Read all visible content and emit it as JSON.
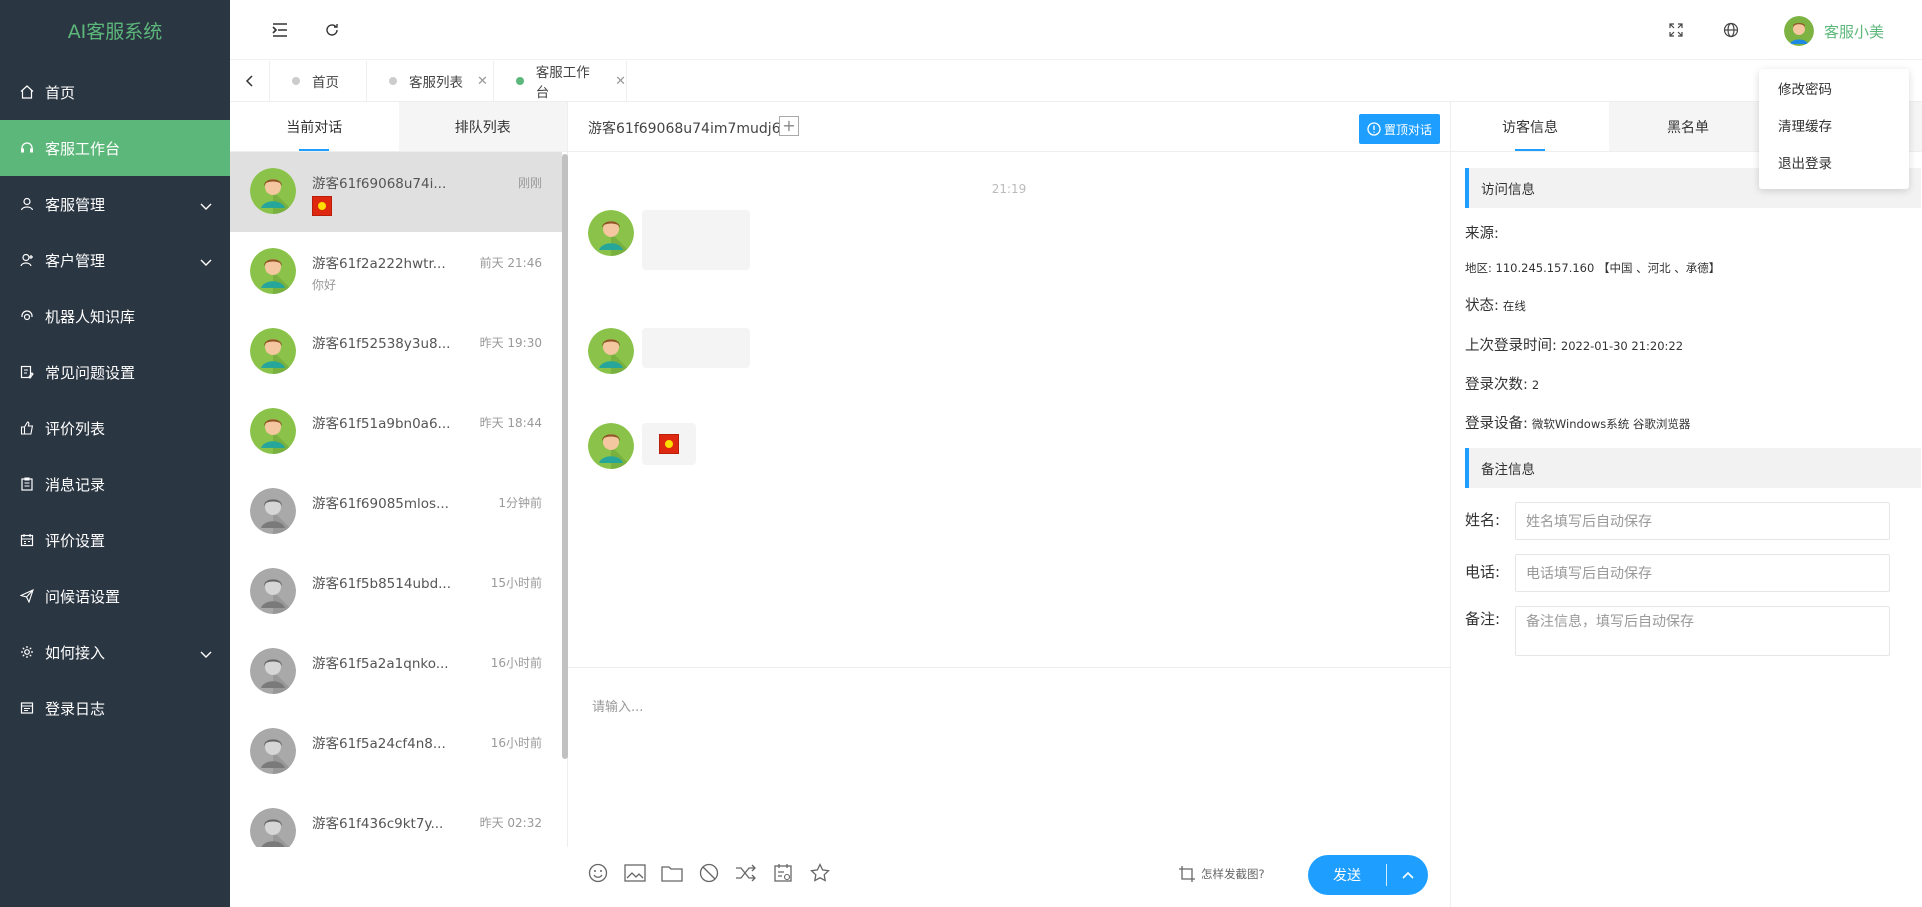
{
  "app": {
    "title": "AI客服系统"
  },
  "sidebar": {
    "items": [
      {
        "label": "首页",
        "icon": "home-icon"
      },
      {
        "label": "客服工作台",
        "icon": "headset-icon",
        "active": true
      },
      {
        "label": "客服管理",
        "icon": "user-icon",
        "expandable": true
      },
      {
        "label": "客户管理",
        "icon": "customer-icon",
        "expandable": true
      },
      {
        "label": "机器人知识库",
        "icon": "robot-icon"
      },
      {
        "label": "常见问题设置",
        "icon": "faq-icon"
      },
      {
        "label": "评价列表",
        "icon": "thumbs-up-icon"
      },
      {
        "label": "消息记录",
        "icon": "clipboard-icon"
      },
      {
        "label": "评价设置",
        "icon": "calendar-icon"
      },
      {
        "label": "问候语设置",
        "icon": "paper-plane-icon"
      },
      {
        "label": "如何接入",
        "icon": "gear-icon",
        "expandable": true
      },
      {
        "label": "登录日志",
        "icon": "log-icon"
      }
    ]
  },
  "header": {
    "user_name": "客服小美"
  },
  "user_menu": {
    "items": [
      "修改密码",
      "清理缓存",
      "退出登录"
    ]
  },
  "tabs": [
    {
      "label": "首页",
      "closable": false
    },
    {
      "label": "客服列表",
      "closable": true
    },
    {
      "label": "客服工作台",
      "closable": true,
      "active": true
    }
  ],
  "conversations": {
    "tabs": [
      "当前对话",
      "排队列表"
    ],
    "list": [
      {
        "name": "游客61f69068u74i...",
        "time": "刚刚",
        "preview": "",
        "flag": true,
        "online": true,
        "selected": true
      },
      {
        "name": "游客61f2a222hwtr...",
        "time": "前天 21:46",
        "preview": "你好",
        "online": true
      },
      {
        "name": "游客61f52538y3u8...",
        "time": "昨天 19:30",
        "preview": "",
        "online": true
      },
      {
        "name": "游客61f51a9bn0a6...",
        "time": "昨天 18:44",
        "preview": "",
        "online": true
      },
      {
        "name": "游客61f69085mlos...",
        "time": "1分钟前",
        "preview": "",
        "online": false
      },
      {
        "name": "游客61f5b8514ubd...",
        "time": "15小时前",
        "preview": "",
        "online": false
      },
      {
        "name": "游客61f5a2a1qnko...",
        "time": "16小时前",
        "preview": "",
        "online": false
      },
      {
        "name": "游客61f5a24cf4n8...",
        "time": "16小时前",
        "preview": "",
        "online": false
      },
      {
        "name": "游客61f436c9kt7y...",
        "time": "昨天 02:32",
        "preview": "",
        "online": false
      }
    ]
  },
  "chat": {
    "title": "游客61f69068u74im7mudj6",
    "top_button": "置顶对话",
    "timestamp": "21:19",
    "input_placeholder": "请输入...",
    "capture_hint": "怎样发截图?",
    "send_label": "发送"
  },
  "visitor": {
    "tabs": [
      "访客信息",
      "黑名单"
    ],
    "section_visit": "访问信息",
    "source_label": "来源:",
    "region": "地区: 110.245.157.160 【中国 、河北 、承德】",
    "status_label": "状态:",
    "status_value": "在线",
    "last_login_label": "上次登录时间:",
    "last_login_value": "2022-01-30 21:20:22",
    "login_count_label": "登录次数:",
    "login_count_value": "2",
    "device_label": "登录设备:",
    "device_value": "微软Windows系统 谷歌浏览器",
    "section_notes": "备注信息",
    "name_label": "姓名:",
    "name_placeholder": "姓名填写后自动保存",
    "phone_label": "电话:",
    "phone_placeholder": "电话填写后自动保存",
    "note_label": "备注:",
    "note_placeholder": "备注信息，填写后自动保存"
  },
  "colors": {
    "sidebar_bg": "#2b3643",
    "accent_green": "#5cb87a",
    "accent_blue": "#1e9fff"
  }
}
